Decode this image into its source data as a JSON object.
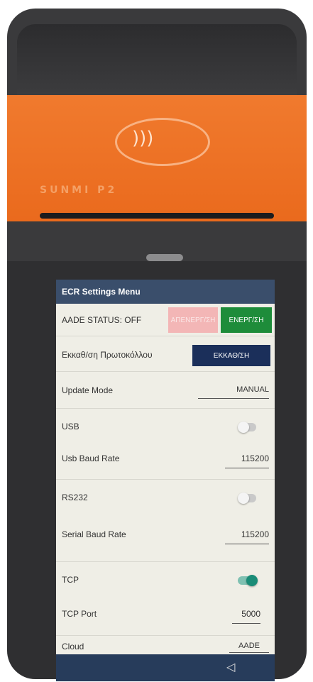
{
  "device": {
    "brand": "SUNMI P2"
  },
  "screen": {
    "title": "ECR Settings Menu",
    "aade": {
      "label": "AADE STATUS: OFF",
      "disable_label": "ΑΠΕΝΕΡΓ/ΣΗ",
      "enable_label": "ΕΝΕΡΓ/ΣΗ"
    },
    "reset": {
      "label": "Εκκαθ/ση Πρωτοκόλλου",
      "button": "ΕΚΚΑΘ/ΣΗ"
    },
    "update_mode": {
      "label": "Update Mode",
      "value": "MANUAL"
    },
    "usb": {
      "label": "USB",
      "enabled": false,
      "baud_label": "Usb Baud Rate",
      "baud_value": "115200"
    },
    "rs232": {
      "label": "RS232",
      "enabled": false,
      "baud_label": "Serial Baud Rate",
      "baud_value": "115200"
    },
    "tcp": {
      "label": "TCP",
      "enabled": true,
      "port_label": "TCP Port",
      "port_value": "5000"
    },
    "cloud": {
      "label": "Cloud",
      "value": "AADE"
    },
    "nav": {
      "back_icon": "back-triangle-icon"
    }
  },
  "colors": {
    "header": "#3a4e6b",
    "enable_green": "#1e8c3a",
    "disable_pink": "#f3b6b6",
    "reset_navy": "#1b2f5a",
    "toggle_on": "#1a8c77",
    "screen_bg": "#efeee6",
    "device_orange": "#ee7125"
  }
}
